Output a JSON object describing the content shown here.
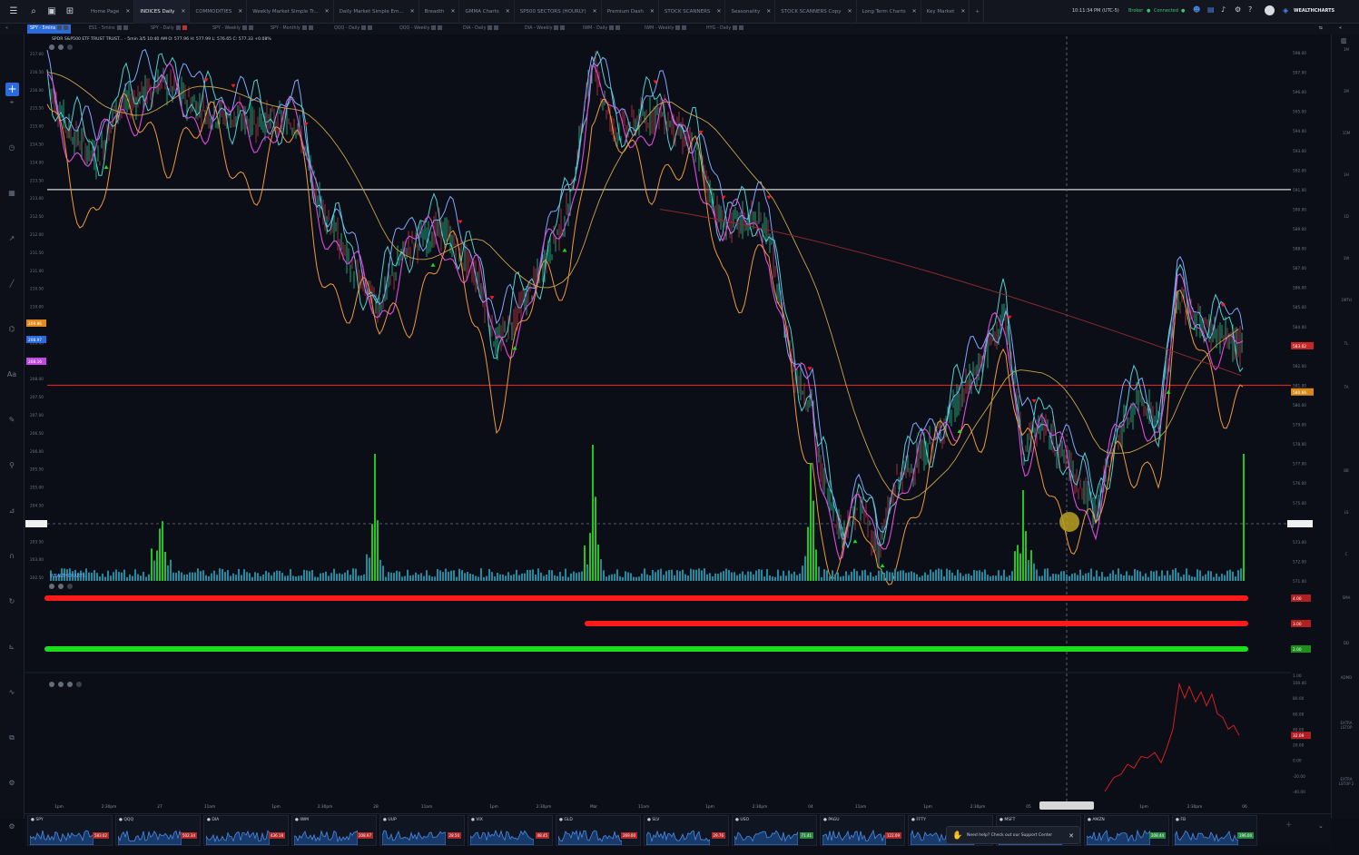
{
  "topbar": {
    "tabs": [
      {
        "label": "Home Page",
        "active": false
      },
      {
        "label": "INDICES Daily",
        "active": true
      },
      {
        "label": "COMMODITIES",
        "active": false
      },
      {
        "label": "Weekly Market Simple Tr...",
        "active": false
      },
      {
        "label": "Daily Market Simple Em...",
        "active": false
      },
      {
        "label": "Breadth",
        "active": false
      },
      {
        "label": "GMMA Charts",
        "active": false
      },
      {
        "label": "SP500 SECTORS (HOURLY)",
        "active": false
      },
      {
        "label": "Premium Dash",
        "active": false
      },
      {
        "label": "STOCK SCANNERS",
        "active": false
      },
      {
        "label": "Seasonality",
        "active": false
      },
      {
        "label": "STOCK SCANNERS Copy",
        "active": false
      },
      {
        "label": "Long Term Charts",
        "active": false
      },
      {
        "label": "Key Market",
        "active": false
      }
    ],
    "add_tab": "+",
    "clock": "10:11:34 PM  (UTC-5)",
    "broker": "Broker",
    "connection": "Connected",
    "brand": "WEALTHCHARTS"
  },
  "chart_tabs": [
    {
      "label": "SPY - 5mins",
      "active": true
    },
    {
      "label": "ES1 - 5mins",
      "active": false
    },
    {
      "label": "SPY - Daily",
      "active": false
    },
    {
      "label": "SPY - Weekly",
      "active": false
    },
    {
      "label": "SPY - Monthly",
      "active": false
    },
    {
      "label": "QQQ - Daily",
      "active": false
    },
    {
      "label": "QQQ - Weekly",
      "active": false
    },
    {
      "label": "DIA - Daily",
      "active": false
    },
    {
      "label": "DIA - Weekly",
      "active": false
    },
    {
      "label": "IWM - Daily",
      "active": false
    },
    {
      "label": "IWM - Weekly",
      "active": false
    },
    {
      "label": "HYG - Daily",
      "active": false
    }
  ],
  "chart_header": "SPDR S&P500 ETF TRUST TRUST... - 5min  3/5 10:40 AM  O: 577.96  H: 577.99  L: 576.65  C: 577.33  +0.08%",
  "chart_data": {
    "type": "line",
    "ylabel_left": "",
    "ylim_left": [
      202.0,
      217.0
    ],
    "left_ticks": [
      "217.00",
      "216.50",
      "216.00",
      "215.50",
      "215.00",
      "214.50",
      "214.00",
      "213.50",
      "213.00",
      "212.50",
      "212.00",
      "211.50",
      "211.00",
      "210.50",
      "210.00",
      "209.50",
      "209.00",
      "208.50",
      "208.00",
      "207.50",
      "207.00",
      "206.50",
      "206.00",
      "205.50",
      "205.00",
      "204.50",
      "204.00",
      "203.50",
      "203.00",
      "202.50"
    ],
    "ylim_right": [
      571.0,
      598.0
    ],
    "right_ticks": [
      "598.00",
      "597.00",
      "596.00",
      "595.00",
      "594.00",
      "593.00",
      "592.00",
      "591.00",
      "590.00",
      "589.00",
      "588.00",
      "587.00",
      "586.00",
      "585.00",
      "584.00",
      "583.00",
      "582.00",
      "581.00",
      "580.00",
      "579.00",
      "578.00",
      "577.00",
      "576.00",
      "575.00",
      "574.00",
      "573.00",
      "572.00",
      "571.00"
    ],
    "x_ticks": [
      "1pm",
      "2:30pm",
      "27",
      "11am",
      "1pm",
      "2:30pm",
      "28",
      "11am",
      "1pm",
      "2:30pm",
      "Mar",
      "11am",
      "1pm",
      "2:30pm",
      "04",
      "11am",
      "1pm",
      "2:30pm",
      "05",
      "1pm",
      "2:30pm",
      "06"
    ],
    "price_labels": {
      "last": "583.02",
      "mid": "580.66",
      "left_top": "209.86",
      "left_mid": "208.97",
      "left_low": "208.16"
    },
    "horizontal_lines": [
      {
        "value": 591.0,
        "color": "#d8d8d8",
        "label": "591.00"
      },
      {
        "value": 581.0,
        "color": "#e02020",
        "label": "581.00"
      }
    ],
    "indicator_panel": {
      "bars": [
        {
          "color": "#ff1a1a",
          "value": 4.0,
          "label": "4.00"
        },
        {
          "color": "#ff1a1a",
          "value": 3.0,
          "label": "3.00"
        },
        {
          "color": "#1adf1a",
          "value": 2.0,
          "label": "2.00"
        }
      ]
    },
    "oscillator": {
      "ticks": [
        "100.00",
        "80.00",
        "60.00",
        "40.00",
        "20.00",
        "0.00",
        "-20.00",
        "-40.00"
      ],
      "last_value": "32.09",
      "top_label": "1.00"
    },
    "right_labels": [
      "1M",
      "3M",
      "15M",
      "1H",
      "1D",
      "1W",
      "1MTH",
      "TL",
      "TA",
      "BB",
      "LS",
      "C",
      "SMA",
      "DD",
      "ADMO",
      "EXTRA LSTOP",
      "EXTRA LSTOP 2"
    ]
  },
  "watchlist": [
    {
      "sym": "SPY",
      "price": "583.02",
      "up": false
    },
    {
      "sym": "QQQ",
      "price": "502.34",
      "up": false
    },
    {
      "sym": "DIA",
      "price": "436.18",
      "up": false
    },
    {
      "sym": "IWM",
      "price": "208.97",
      "up": false
    },
    {
      "sym": "UUP",
      "price": "28.50",
      "up": false
    },
    {
      "sym": "VIX",
      "price": "48.45",
      "up": false
    },
    {
      "sym": "GLD",
      "price": "269.00",
      "up": false
    },
    {
      "sym": "SLV",
      "price": "29.76",
      "up": false
    },
    {
      "sym": "USO",
      "price": "71.41",
      "up": true
    },
    {
      "sym": "PAGU",
      "price": "122.09",
      "up": false
    },
    {
      "sym": "FFTY",
      "price": "29.38",
      "up": true
    },
    {
      "sym": "MSFT",
      "price": "",
      "up": false
    },
    {
      "sym": "AMZN",
      "price": "208.44",
      "up": true
    },
    {
      "sym": "FB",
      "price": "196.00",
      "up": true
    }
  ],
  "helptip": "Need help? Check out our Support Center",
  "colors": {
    "accent": "#2a6be0",
    "bull": "#1adf1a",
    "bear": "#ff1a1a",
    "bg": "#0b0e16"
  }
}
